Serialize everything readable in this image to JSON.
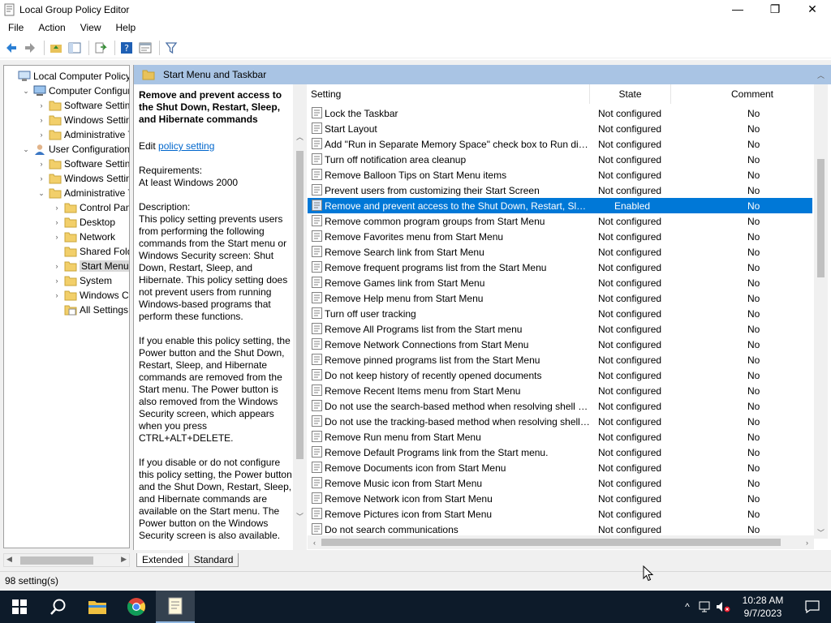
{
  "window": {
    "title": "Local Group Policy Editor",
    "minimize": "—",
    "maximize": "❐",
    "close": "✕"
  },
  "menu": [
    "File",
    "Action",
    "View",
    "Help"
  ],
  "tree": {
    "items": [
      {
        "label": "Local Computer Policy",
        "level": 0,
        "expander": "",
        "icon": "computer-policy-icon"
      },
      {
        "label": "Computer Configura",
        "level": 1,
        "expander": "⌄",
        "icon": "computer-icon"
      },
      {
        "label": "Software Settings",
        "level": 2,
        "expander": "›",
        "icon": "folder-icon"
      },
      {
        "label": "Windows Setting",
        "level": 2,
        "expander": "›",
        "icon": "folder-icon"
      },
      {
        "label": "Administrative Te",
        "level": 2,
        "expander": "›",
        "icon": "folder-icon"
      },
      {
        "label": "User Configuration",
        "level": 1,
        "expander": "⌄",
        "icon": "user-icon"
      },
      {
        "label": "Software Settings",
        "level": 2,
        "expander": "›",
        "icon": "folder-icon"
      },
      {
        "label": "Windows Setting",
        "level": 2,
        "expander": "›",
        "icon": "folder-icon"
      },
      {
        "label": "Administrative Te",
        "level": 2,
        "expander": "⌄",
        "icon": "folder-icon"
      },
      {
        "label": "Control Panel",
        "level": 3,
        "expander": "›",
        "icon": "folder-icon"
      },
      {
        "label": "Desktop",
        "level": 3,
        "expander": "›",
        "icon": "folder-icon"
      },
      {
        "label": "Network",
        "level": 3,
        "expander": "›",
        "icon": "folder-icon"
      },
      {
        "label": "Shared Folder",
        "level": 3,
        "expander": "",
        "icon": "folder-icon"
      },
      {
        "label": "Start Menu ar",
        "level": 3,
        "expander": "›",
        "icon": "folder-icon",
        "selected": true
      },
      {
        "label": "System",
        "level": 3,
        "expander": "›",
        "icon": "folder-icon"
      },
      {
        "label": "Windows Cor",
        "level": 3,
        "expander": "›",
        "icon": "folder-icon"
      },
      {
        "label": "All Settings",
        "level": 3,
        "expander": "",
        "icon": "settings-list-icon"
      }
    ]
  },
  "panel": {
    "header": "Start Menu and Taskbar",
    "desc_title": "Remove and prevent access to the Shut Down, Restart, Sleep, and Hibernate commands",
    "edit_prefix": "Edit ",
    "edit_link": "policy setting ",
    "requirements_label": "Requirements:",
    "requirements_value": "At least Windows 2000",
    "description_label": "Description:",
    "description_p1": "This policy setting prevents users from performing the following commands from the Start menu or Windows Security screen: Shut Down, Restart, Sleep, and Hibernate. This policy setting does not prevent users from running Windows-based programs that perform these functions.",
    "description_p2": "If you enable this policy setting, the Power button and the Shut Down, Restart, Sleep, and Hibernate commands are removed from the Start menu. The Power button is also removed from the Windows Security screen, which appears when you press CTRL+ALT+DELETE.",
    "description_p3": "If you disable or do not configure this policy setting, the Power button and the Shut Down, Restart, Sleep, and Hibernate commands are available on the Start menu. The Power button on the Windows Security screen is also available."
  },
  "list": {
    "headers": {
      "setting": "Setting",
      "state": "State",
      "comment": "Comment"
    },
    "rows": [
      {
        "setting": "Lock the Taskbar",
        "state": "Not configured",
        "comment": "No"
      },
      {
        "setting": "Start Layout",
        "state": "Not configured",
        "comment": "No"
      },
      {
        "setting": "Add \"Run in Separate Memory Space\" check box to Run dial...",
        "state": "Not configured",
        "comment": "No"
      },
      {
        "setting": "Turn off notification area cleanup",
        "state": "Not configured",
        "comment": "No"
      },
      {
        "setting": "Remove Balloon Tips on Start Menu items",
        "state": "Not configured",
        "comment": "No"
      },
      {
        "setting": "Prevent users from customizing their Start Screen",
        "state": "Not configured",
        "comment": "No"
      },
      {
        "setting": "Remove and prevent access to the Shut Down, Restart, Sleep...",
        "state": "Enabled",
        "comment": "No",
        "selected": true
      },
      {
        "setting": "Remove common program groups from Start Menu",
        "state": "Not configured",
        "comment": "No"
      },
      {
        "setting": "Remove Favorites menu from Start Menu",
        "state": "Not configured",
        "comment": "No"
      },
      {
        "setting": "Remove Search link from Start Menu",
        "state": "Not configured",
        "comment": "No"
      },
      {
        "setting": "Remove frequent programs list from the Start Menu",
        "state": "Not configured",
        "comment": "No"
      },
      {
        "setting": "Remove Games link from Start Menu",
        "state": "Not configured",
        "comment": "No"
      },
      {
        "setting": "Remove Help menu from Start Menu",
        "state": "Not configured",
        "comment": "No"
      },
      {
        "setting": "Turn off user tracking",
        "state": "Not configured",
        "comment": "No"
      },
      {
        "setting": "Remove All Programs list from the Start menu",
        "state": "Not configured",
        "comment": "No"
      },
      {
        "setting": "Remove Network Connections from Start Menu",
        "state": "Not configured",
        "comment": "No"
      },
      {
        "setting": "Remove pinned programs list from the Start Menu",
        "state": "Not configured",
        "comment": "No"
      },
      {
        "setting": "Do not keep history of recently opened documents",
        "state": "Not configured",
        "comment": "No"
      },
      {
        "setting": "Remove Recent Items menu from Start Menu",
        "state": "Not configured",
        "comment": "No"
      },
      {
        "setting": "Do not use the search-based method when resolving shell s...",
        "state": "Not configured",
        "comment": "No"
      },
      {
        "setting": "Do not use the tracking-based method when resolving shell ...",
        "state": "Not configured",
        "comment": "No"
      },
      {
        "setting": "Remove Run menu from Start Menu",
        "state": "Not configured",
        "comment": "No"
      },
      {
        "setting": "Remove Default Programs link from the Start menu.",
        "state": "Not configured",
        "comment": "No"
      },
      {
        "setting": "Remove Documents icon from Start Menu",
        "state": "Not configured",
        "comment": "No"
      },
      {
        "setting": "Remove Music icon from Start Menu",
        "state": "Not configured",
        "comment": "No"
      },
      {
        "setting": "Remove Network icon from Start Menu",
        "state": "Not configured",
        "comment": "No"
      },
      {
        "setting": "Remove Pictures icon from Start Menu",
        "state": "Not configured",
        "comment": "No"
      },
      {
        "setting": "Do not search communications",
        "state": "Not configured",
        "comment": "No"
      }
    ]
  },
  "tabs": [
    {
      "label": "Extended",
      "active": true
    },
    {
      "label": "Standard",
      "active": false
    }
  ],
  "status": {
    "text": "98 setting(s)"
  },
  "taskbar": {
    "time": "10:28 AM",
    "date": "9/7/2023",
    "tray_chevron": "^"
  },
  "colors": {
    "selection": "#0078d7",
    "header_band": "#a9c4e4",
    "link": "#0066cc",
    "taskbar": "#0d1b2a"
  }
}
